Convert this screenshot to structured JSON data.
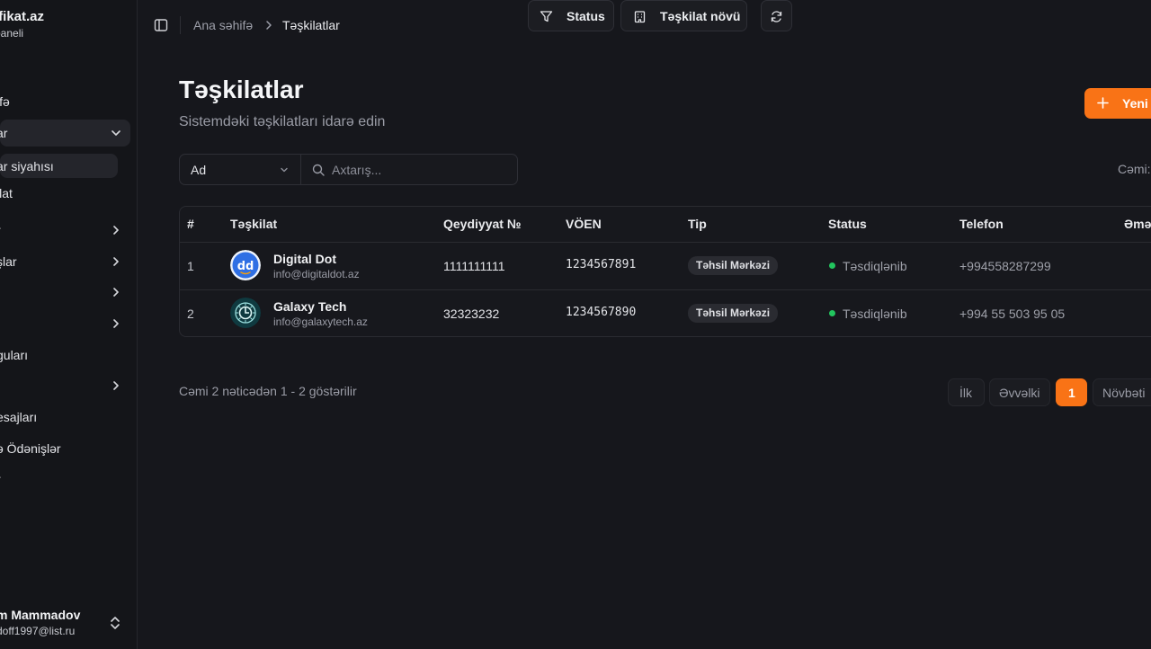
{
  "sidebar": {
    "brand_title": "ifikat.az",
    "brand_sub": "baneli",
    "items": [
      {
        "label": "ifə"
      },
      {
        "label": "ar"
      },
      {
        "label": "ar siyahısı"
      },
      {
        "label": "ilat"
      },
      {
        "label": "r"
      },
      {
        "label": "şlar"
      },
      {
        "label": ""
      },
      {
        "label": ""
      },
      {
        "label": "guları"
      },
      {
        "label": ""
      },
      {
        "label": "esajları"
      },
      {
        "label": "ə Ödənişlər"
      },
      {
        "label": "r"
      }
    ],
    "user_name": "m Mammadov",
    "user_email": "doff1997@list.ru"
  },
  "breadcrumb": {
    "home": "Ana səhifə",
    "current": "Təşkilatlar"
  },
  "page": {
    "title": "Təşkilatlar",
    "subtitle": "Sistemdəki təşkilatları idarə edin",
    "new_button": "Yeni"
  },
  "filters": {
    "field_value": "Ad",
    "search_placeholder": "Axtarış...",
    "status_label": "Status",
    "type_label": "Təşkilat növü",
    "total_label": "Cəmi:"
  },
  "table": {
    "headers": [
      "#",
      "Təşkilat",
      "Qeydiyyat №",
      "VÖEN",
      "Tip",
      "Status",
      "Telefon",
      "Əmə"
    ],
    "rows": [
      {
        "no": "1",
        "name": "Digital Dot",
        "email": "info@digitaldot.az",
        "reg": "1111111111",
        "voen": "1234567891",
        "type": "Təhsil Mərkəzi",
        "status": "Təsdiqlənib",
        "phone": "+994558287299"
      },
      {
        "no": "2",
        "name": "Galaxy Tech",
        "email": "info@galaxytech.az",
        "reg": "32323232",
        "voen": "1234567890",
        "type": "Təhsil Mərkəzi",
        "status": "Təsdiqlənib",
        "phone": "+994 55 503 95 05"
      }
    ]
  },
  "pagination": {
    "summary": "Cəmi 2 nəticədən 1 - 2 göstərilir",
    "first": "İlk",
    "prev": "Əvvəlki",
    "current": "1",
    "next": "Növbəti"
  },
  "colors": {
    "accent": "#f97316",
    "success": "#22c55e",
    "background": "#16171c"
  },
  "icons": [
    "sidebar-toggle-icon",
    "chevron-right-icon",
    "chevron-down-icon",
    "plus-icon",
    "search-icon",
    "filter-icon",
    "building-icon",
    "refresh-icon",
    "chevrons-up-down-icon"
  ]
}
